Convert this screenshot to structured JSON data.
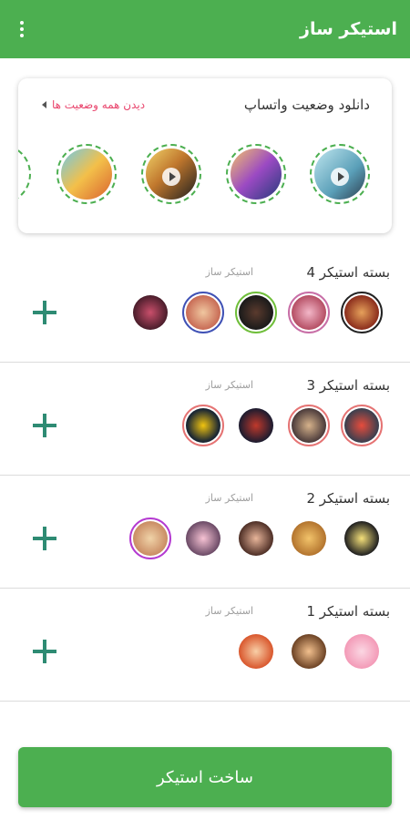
{
  "colors": {
    "primary": "#4caf50",
    "link": "#e9456d",
    "add": "#2e8b73",
    "divider": "#dcdcdc",
    "muted": "#9e9e9e"
  },
  "appbar": {
    "title": "استیکر ساز",
    "menu_icon": "overflow-menu-icon"
  },
  "status_card": {
    "title": "دانلود وضعیت واتساپ",
    "see_all": "دیدن همه وضعیت ها",
    "items": [
      {
        "gradient": "linear-gradient(135deg,#bfe6ef,#5a9fb8 60%,#2c3e50)",
        "video": true
      },
      {
        "gradient": "linear-gradient(135deg,#f4c36a,#9b4ac3 50%,#253b7a)",
        "video": false
      },
      {
        "gradient": "linear-gradient(135deg,#f2d46a,#c0772d 45%,#1f1f1f)",
        "video": true
      },
      {
        "gradient": "linear-gradient(135deg,#6ec9e9,#f3c04a 50%,#d9622f)",
        "video": false
      }
    ]
  },
  "packs": [
    {
      "name": "بسته استیکر 4",
      "author": "استیکر ساز",
      "stickers": [
        {
          "gradient": "radial-gradient(circle,#e6a15b,#8b2d1c 70%)",
          "border": "#222222"
        },
        {
          "gradient": "radial-gradient(circle,#f3b7c8,#b54e64 70%)",
          "border": "#c86ea6"
        },
        {
          "gradient": "radial-gradient(circle,#5b3b2e,#1a1a1a 70%)",
          "border": "#6fbe3a"
        },
        {
          "gradient": "radial-gradient(circle,#f0c7a0,#c86b55 70%)",
          "border": "#3f51b5"
        },
        {
          "gradient": "radial-gradient(circle,#c94f6b,#4a1d2b 70%)",
          "border": "#ffffff"
        }
      ]
    },
    {
      "name": "بسته استیکر 3",
      "author": "استیکر ساز",
      "stickers": [
        {
          "gradient": "radial-gradient(circle,#e74c3c,#2c3e50 75%)",
          "border": "#e57373"
        },
        {
          "gradient": "radial-gradient(circle,#d6b28b,#4a3a3a 70%)",
          "border": "#e57373"
        },
        {
          "gradient": "radial-gradient(circle,#c0392b,#1b1b2f 70%)",
          "border": "#ffffff"
        },
        {
          "gradient": "radial-gradient(circle,#f1c40f,#1c2833 65%)",
          "border": "#e57373"
        }
      ]
    },
    {
      "name": "بسته استیکر 2",
      "author": "استیکر ساز",
      "stickers": [
        {
          "gradient": "radial-gradient(circle,#f5e17a,#1f1f1f 70%)",
          "border": "#ffffff"
        },
        {
          "gradient": "radial-gradient(circle,#f2c36a,#b3742e 70%)",
          "border": "#ffffff"
        },
        {
          "gradient": "radial-gradient(circle,#e8b59a,#4e2f26 70%)",
          "border": "#ffffff"
        },
        {
          "gradient": "radial-gradient(circle,#f7c3d4,#6b4a66 70%)",
          "border": "#ffffff"
        },
        {
          "gradient": "radial-gradient(circle,#f0d3a8,#c98c64 70%)",
          "border": "#b43ad1"
        }
      ]
    },
    {
      "name": "بسته استیکر 1",
      "author": "استیکر ساز",
      "stickers": [
        {
          "gradient": "radial-gradient(circle,#fbd7e3,#f39ab7 70%)",
          "border": "#ffffff"
        },
        {
          "gradient": "radial-gradient(circle,#f2c08e,#6d4325 70%)",
          "border": "#ffffff"
        },
        {
          "gradient": "radial-gradient(circle,#f8cfa7,#d9572d 70%)",
          "border": "#ffffff"
        }
      ]
    }
  ],
  "create_button": {
    "label": "ساخت استیکر"
  }
}
